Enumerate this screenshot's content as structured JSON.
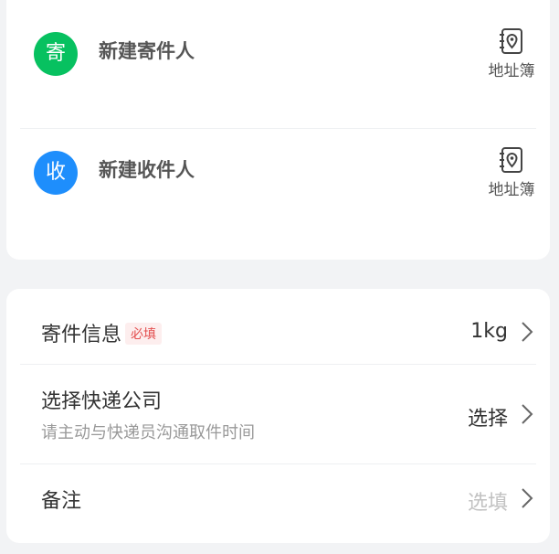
{
  "address": {
    "sender": {
      "badge": "寄",
      "label": "新建寄件人",
      "book_label": "地址簿",
      "color": "#07c160"
    },
    "receiver": {
      "badge": "收",
      "label": "新建收件人",
      "book_label": "地址簿",
      "color": "#1e8efc"
    }
  },
  "info": {
    "parcel": {
      "title": "寄件信息",
      "tag": "必填",
      "value": "1kg"
    },
    "courier": {
      "title": "选择快递公司",
      "subtitle": "请主动与快递员沟通取件时间",
      "value": "选择"
    },
    "remark": {
      "title": "备注",
      "placeholder": "选填"
    }
  },
  "icons": {
    "address_book": "address-book-icon",
    "chevron": "chevron-right-icon"
  }
}
